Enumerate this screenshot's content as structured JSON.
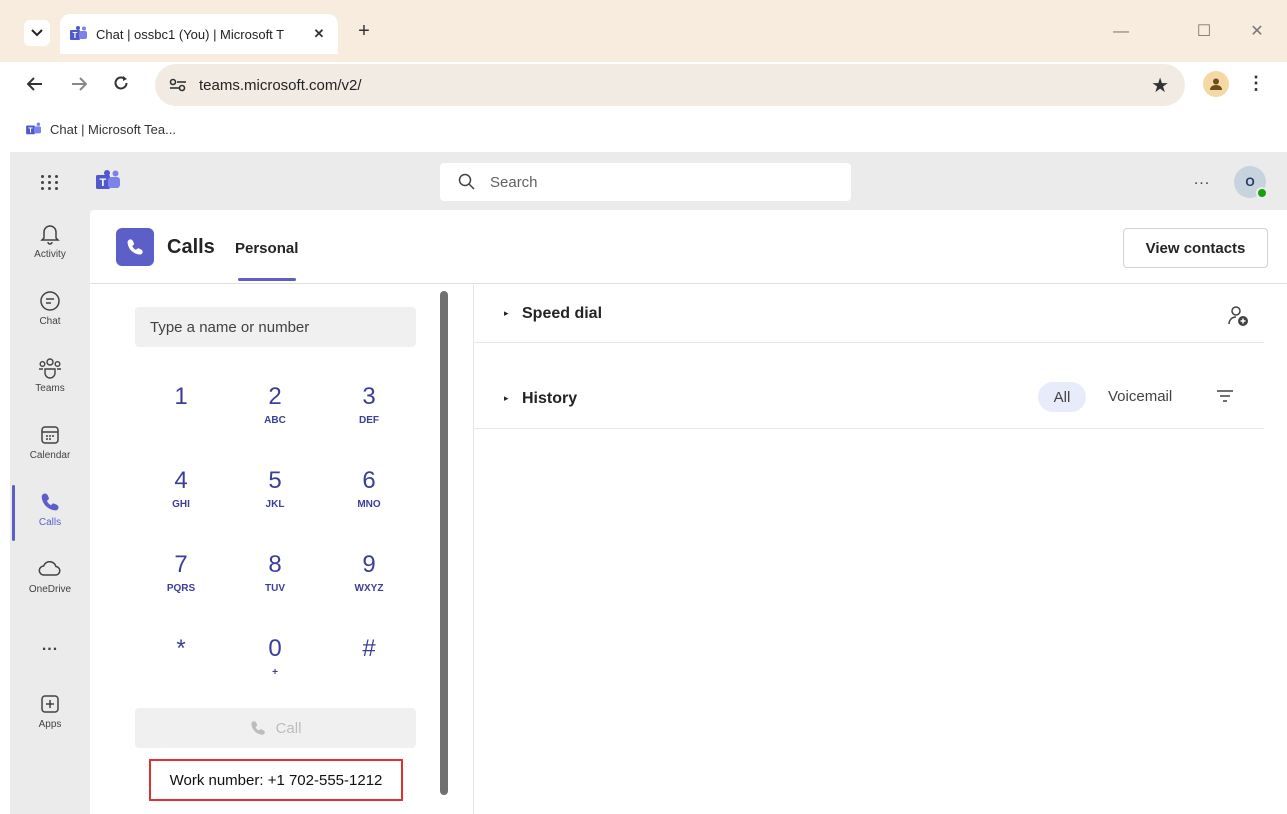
{
  "browser": {
    "tab_title": "Chat | ossbc1 (You) | Microsoft T",
    "tab_close": "✕",
    "new_tab": "+",
    "url": "teams.microsoft.com/v2/",
    "bookmark_label": "Chat | Microsoft Tea...",
    "window_minimize": "—",
    "window_maximize": "☐",
    "window_close": "✕"
  },
  "app": {
    "search_placeholder": "Search",
    "more_label": "...",
    "avatar_initials": "O",
    "rail": [
      {
        "label": "Activity",
        "icon": "bell-icon"
      },
      {
        "label": "Chat",
        "icon": "chat-icon"
      },
      {
        "label": "Teams",
        "icon": "teams-icon"
      },
      {
        "label": "Calendar",
        "icon": "calendar-icon"
      },
      {
        "label": "Calls",
        "icon": "phone-icon",
        "active": true
      },
      {
        "label": "OneDrive",
        "icon": "cloud-icon"
      },
      {
        "label": "...",
        "icon": "more-icon"
      },
      {
        "label": "Apps",
        "icon": "plus-square-icon"
      }
    ]
  },
  "calls": {
    "title": "Calls",
    "tab_personal": "Personal",
    "view_contacts": "View contacts",
    "dial_placeholder": "Type a name or number",
    "keys": [
      {
        "digit": "1",
        "letters": ""
      },
      {
        "digit": "2",
        "letters": "ABC"
      },
      {
        "digit": "3",
        "letters": "DEF"
      },
      {
        "digit": "4",
        "letters": "GHI"
      },
      {
        "digit": "5",
        "letters": "JKL"
      },
      {
        "digit": "6",
        "letters": "MNO"
      },
      {
        "digit": "7",
        "letters": "PQRS"
      },
      {
        "digit": "8",
        "letters": "TUV"
      },
      {
        "digit": "9",
        "letters": "WXYZ"
      },
      {
        "digit": "*",
        "letters": ""
      },
      {
        "digit": "0",
        "letters": "+"
      },
      {
        "digit": "#",
        "letters": ""
      }
    ],
    "call_button": "Call",
    "work_number": "Work number: +1 702-555-1212",
    "speed_dial": "Speed dial",
    "history": "History",
    "filter_all": "All",
    "filter_voicemail": "Voicemail"
  },
  "colors": {
    "accent": "#5b5fc7",
    "browser_frame": "#f8ecde",
    "highlight_box": "#e03030"
  }
}
